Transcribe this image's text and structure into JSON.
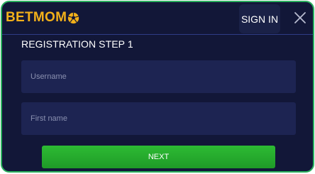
{
  "brand": {
    "logo_text": "BETMOM",
    "logo_color": "#f2b01a"
  },
  "header": {
    "signin_label": "SIGN IN",
    "close_icon": "close-icon"
  },
  "form": {
    "title": "REGISTRATION STEP 1",
    "username_placeholder": "Username",
    "firstname_placeholder": "First name",
    "next_label": "NEXT"
  },
  "colors": {
    "background": "#121738",
    "border": "#2bb05e",
    "field_bg": "#1d2452",
    "button": "#27ae2f"
  }
}
